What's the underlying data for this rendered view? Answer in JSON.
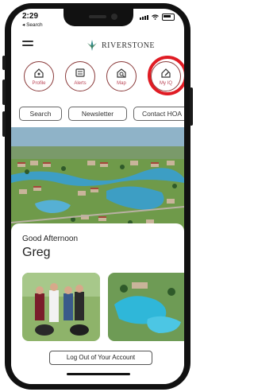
{
  "status_bar": {
    "time": "2:29",
    "back_label": "◂ Search"
  },
  "brand": {
    "name": "RIVERSTONE"
  },
  "nav_icons": [
    {
      "label": "Profile"
    },
    {
      "label": "Alerts"
    },
    {
      "label": "Map"
    },
    {
      "label": "My IQ"
    }
  ],
  "quick_links": [
    "Search",
    "Newsletter",
    "Contact HOA"
  ],
  "greeting": {
    "salutation": "Good Afternoon",
    "name": "Greg"
  },
  "footer": {
    "logout_label": "Log Out of Your Account"
  },
  "colors": {
    "icon_accent": "#8a3a3a",
    "highlight": "#e01c24",
    "lake": "#3d9ec4",
    "grass": "#5c8a3c"
  }
}
